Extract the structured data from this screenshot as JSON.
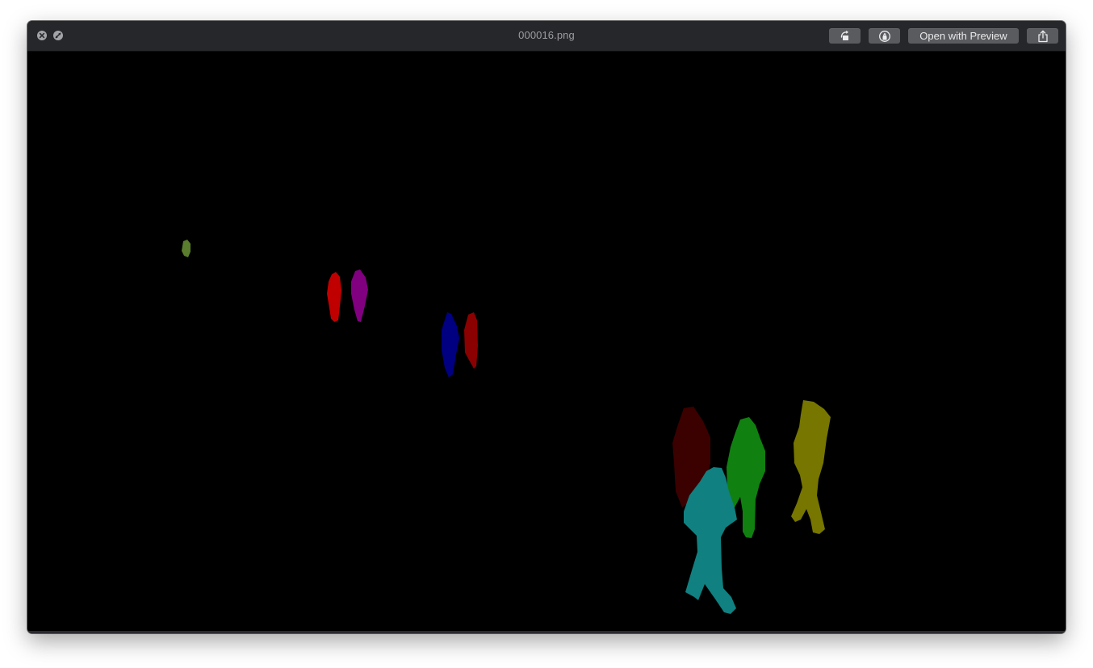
{
  "window": {
    "title": "000016.png",
    "open_with_label": "Open with Preview"
  },
  "icons": {
    "close": "close-icon",
    "fullscreen": "fullscreen-icon",
    "rotate": "rotate-icon",
    "markup": "markup-icon",
    "share": "share-icon"
  },
  "image": {
    "background": "#000000",
    "segment_colors": [
      "#5a7d2e",
      "#c00000",
      "#800080",
      "#000080",
      "#8b0000",
      "#3b0000",
      "#008000",
      "#808000",
      "#108080"
    ]
  }
}
